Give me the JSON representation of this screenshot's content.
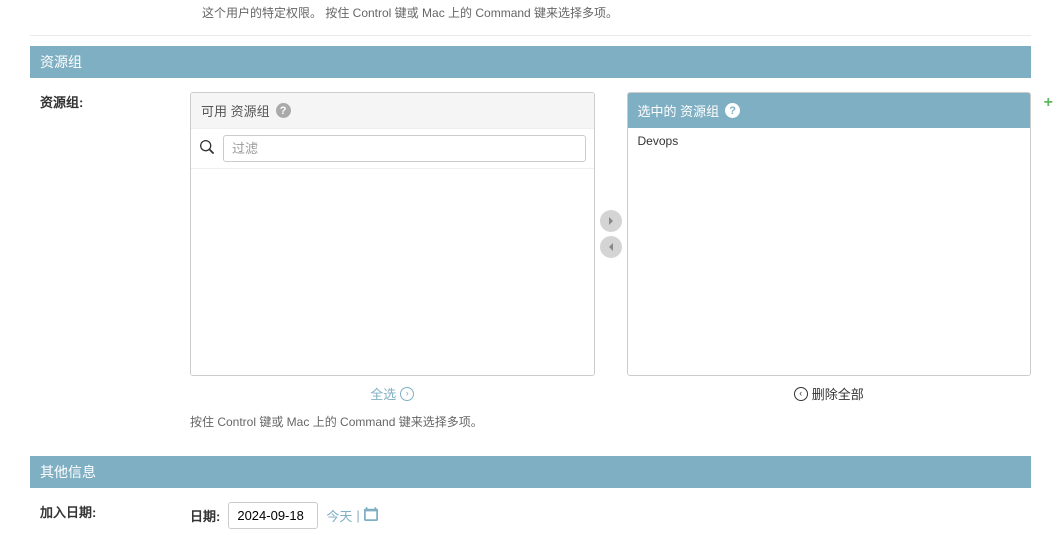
{
  "permissions": {
    "help_text": "这个用户的特定权限。 按住 Control 键或 Mac 上的 Command 键来选择多项。"
  },
  "resource_group": {
    "section_title": "资源组",
    "label": "资源组:",
    "available": {
      "header": "可用 资源组",
      "filter_placeholder": "过滤"
    },
    "chosen": {
      "header": "选中的 资源组",
      "items": [
        "Devops"
      ]
    },
    "select_all": "全选",
    "remove_all": "删除全部",
    "help_text": "按住 Control 键或 Mac 上的 Command 键来选择多项。"
  },
  "other_info": {
    "section_title": "其他信息",
    "join_date_label": "加入日期:",
    "date_field_label": "日期:",
    "date_value": "2024-09-18",
    "today_link": "今天",
    "separator": "|"
  }
}
